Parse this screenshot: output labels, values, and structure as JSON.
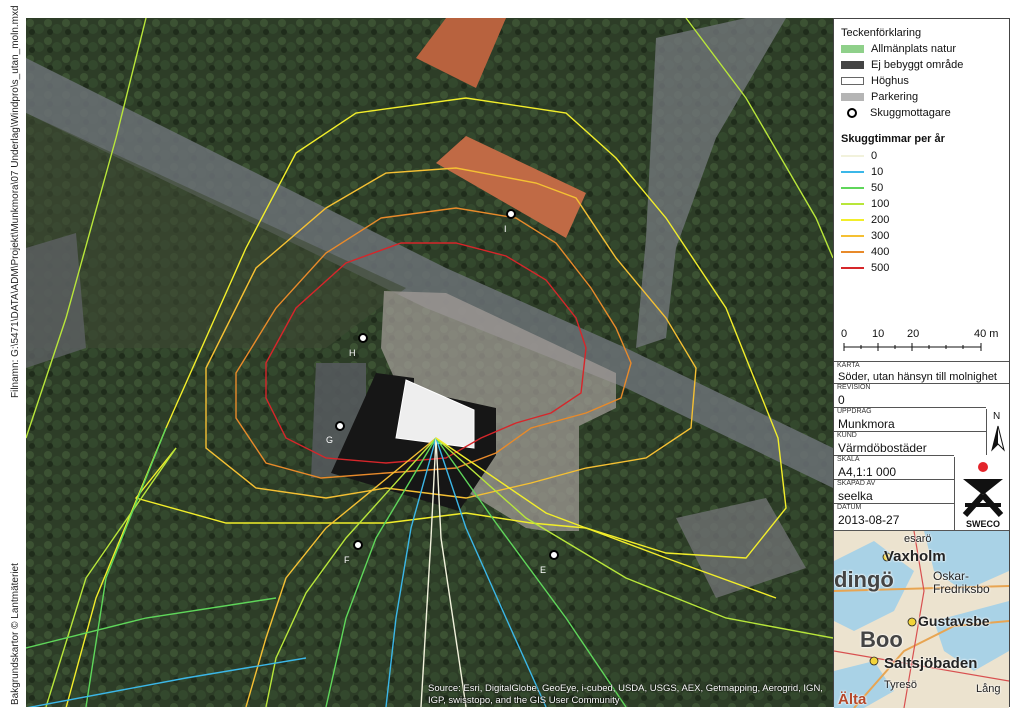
{
  "sidebar": {
    "filename": "Filnamn: G:\\5471\\DATA\\ADM\\Projekt\\Munkmora\\07 Underlag\\Windpro\\s_utan_moln.mxd",
    "background_credit": "Bakgrundskartor © Lantmäteriet"
  },
  "map": {
    "attribution": "Source: Esri, DigitalGlobe, GeoEye, i-cubed, USDA, USGS, AEX, Getmapping, Aerogrid, IGN, IGP, swisstopo, and the GIS User Community",
    "receptors": [
      {
        "label": "I"
      },
      {
        "label": "H"
      },
      {
        "label": "G"
      },
      {
        "label": "F"
      },
      {
        "label": "E"
      }
    ]
  },
  "legend": {
    "title": "Teckenförklaring",
    "items": [
      {
        "label": "Allmänplats natur",
        "color": "#8fd08a",
        "kind": "fill"
      },
      {
        "label": "Ej bebyggt område",
        "color": "#444444",
        "kind": "fill"
      },
      {
        "label": "Höghus",
        "color": "#ffffff",
        "kind": "outline"
      },
      {
        "label": "Parkering",
        "color": "#b5b5b5",
        "kind": "fill"
      },
      {
        "label": "Skuggmottagare",
        "color": "#000000",
        "kind": "point"
      }
    ],
    "shadow_title": "Skuggtimmar per år",
    "shadow_levels": [
      {
        "label": "0",
        "color": "#f2f2dc"
      },
      {
        "label": "10",
        "color": "#3bb7e8"
      },
      {
        "label": "50",
        "color": "#5fd65a"
      },
      {
        "label": "100",
        "color": "#b8e63a"
      },
      {
        "label": "200",
        "color": "#f2ee2a"
      },
      {
        "label": "300",
        "color": "#f5c033"
      },
      {
        "label": "400",
        "color": "#e88a2a"
      },
      {
        "label": "500",
        "color": "#d6262a"
      }
    ]
  },
  "scale": {
    "labels": [
      "0",
      "10",
      "20",
      "40 m"
    ]
  },
  "info": {
    "karta_label": "KARTA",
    "karta": "Söder, utan hänsyn till molnighet",
    "revision_label": "REVISION",
    "revision": "0",
    "uppdrag_label": "UPPDRAG",
    "uppdrag": "Munkmora",
    "kund_label": "KUND",
    "kund": "Värmdöbostäder",
    "skala_label": "SKALA",
    "skala": "A4,1:1 000",
    "skapad_label": "SKAPAD AV",
    "skapad": "seelka",
    "datum_label": "DATUM",
    "datum": "2013-08-27",
    "north": "N",
    "logo_text": "SWECO"
  },
  "inset": {
    "places": [
      "Vaxholm",
      "Oskar-",
      "Fredriksbo",
      "dingö",
      "Gustavsbe",
      "Boo",
      "Saltsjöbaden",
      "Tyresö",
      "Lång",
      "Älta",
      "esarö"
    ]
  }
}
